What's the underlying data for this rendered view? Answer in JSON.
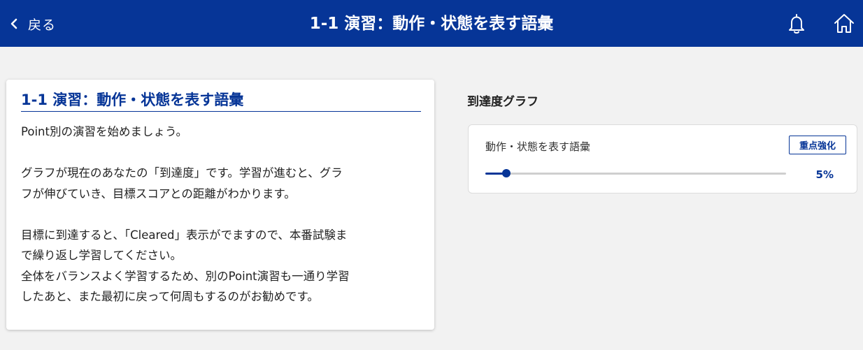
{
  "header": {
    "back_label": "戻る",
    "title": "1-1 演習：動作・状態を表す語彙",
    "bell_icon": "bell-icon",
    "home_icon": "home-icon",
    "background": "#063597"
  },
  "intro": {
    "title": "1-1 演習：動作・状態を表す語彙",
    "lines": [
      "Point別の演習を始めましょう。",
      "",
      "グラフが現在のあなたの「到達度」です。学習が進むと、グラ",
      "フが伸びていき、目標スコアとの距離がわかります。",
      "",
      "目標に到達すると、「Cleared」表示がでますので、本番試験ま",
      "で繰り返し学習してください。",
      "全体をバランスよく学習するため、別のPoint演習も一通り学習",
      "したあと、また最初に戻って何周もするのがお勧めです。"
    ]
  },
  "graph": {
    "heading": "到達度グラフ",
    "item_name": "動作・状態を表す語彙",
    "badge": "重点強化",
    "progress": 0.07,
    "percent_label": "5%",
    "accent": "#063597"
  }
}
